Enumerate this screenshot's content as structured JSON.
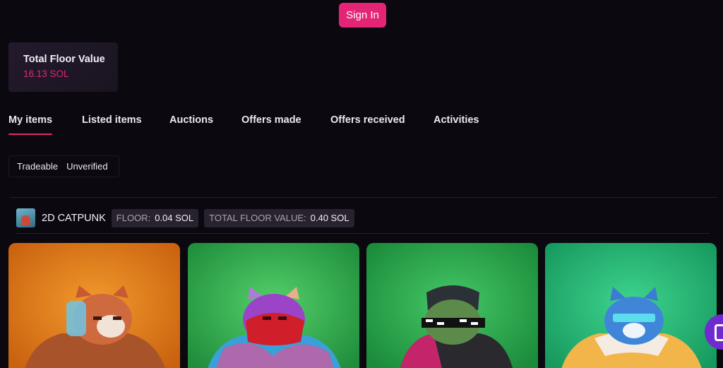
{
  "header": {
    "sign_in_label": "Sign In"
  },
  "summary": {
    "title": "Total Floor Value",
    "value": "16.13 SOL"
  },
  "tabs": [
    {
      "label": "My items",
      "active": true
    },
    {
      "label": "Listed items"
    },
    {
      "label": "Auctions"
    },
    {
      "label": "Offers made"
    },
    {
      "label": "Offers received"
    },
    {
      "label": "Activities"
    }
  ],
  "filters": [
    "Tradeable",
    "Unverified"
  ],
  "collection": {
    "name": "2D CATPUNK",
    "floor_label": "FLOOR:",
    "floor_value": "0.04 SOL",
    "total_label": "TOTAL FLOOR VALUE:",
    "total_value": "0.40 SOL"
  },
  "items": [
    {
      "bg": "#e07a1c",
      "icon": "nft-catpunk-orange-icon"
    },
    {
      "bg": "#2fb352",
      "icon": "nft-catpunk-tiedye-icon"
    },
    {
      "bg": "#2aa84c",
      "icon": "nft-catpunk-green-icon"
    },
    {
      "bg": "#22b574",
      "icon": "nft-catpunk-blue-icon"
    }
  ],
  "colors": {
    "accent": "#e42575",
    "background": "#0b080f",
    "chat": "#6f2bd0"
  },
  "icons": {
    "chat": "chat-icon"
  }
}
